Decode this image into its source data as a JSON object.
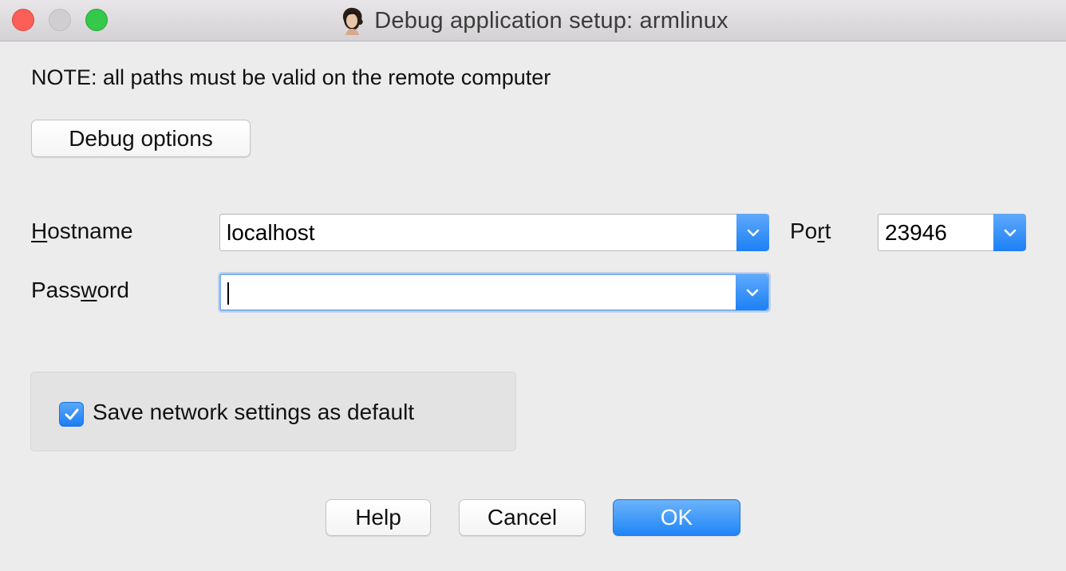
{
  "window": {
    "title": "Debug application setup: armlinux"
  },
  "note": "NOTE: all paths must be valid on the remote computer",
  "debug_options_label": "Debug options",
  "fields": {
    "hostname": {
      "label_pre": "",
      "label_mnemonic": "H",
      "label_post": "ostname",
      "value": "localhost"
    },
    "password": {
      "label_pre": "Pass",
      "label_mnemonic": "w",
      "label_post": "ord",
      "value": ""
    },
    "port": {
      "label_pre": "Po",
      "label_mnemonic": "r",
      "label_post": "t",
      "value": "23946"
    }
  },
  "save_default": {
    "label": "Save network settings as default",
    "checked": true
  },
  "buttons": {
    "help": "Help",
    "cancel": "Cancel",
    "ok": "OK"
  },
  "colors": {
    "accent": "#1f86f7",
    "close": "#fc5f57",
    "maximize": "#35c84a"
  }
}
